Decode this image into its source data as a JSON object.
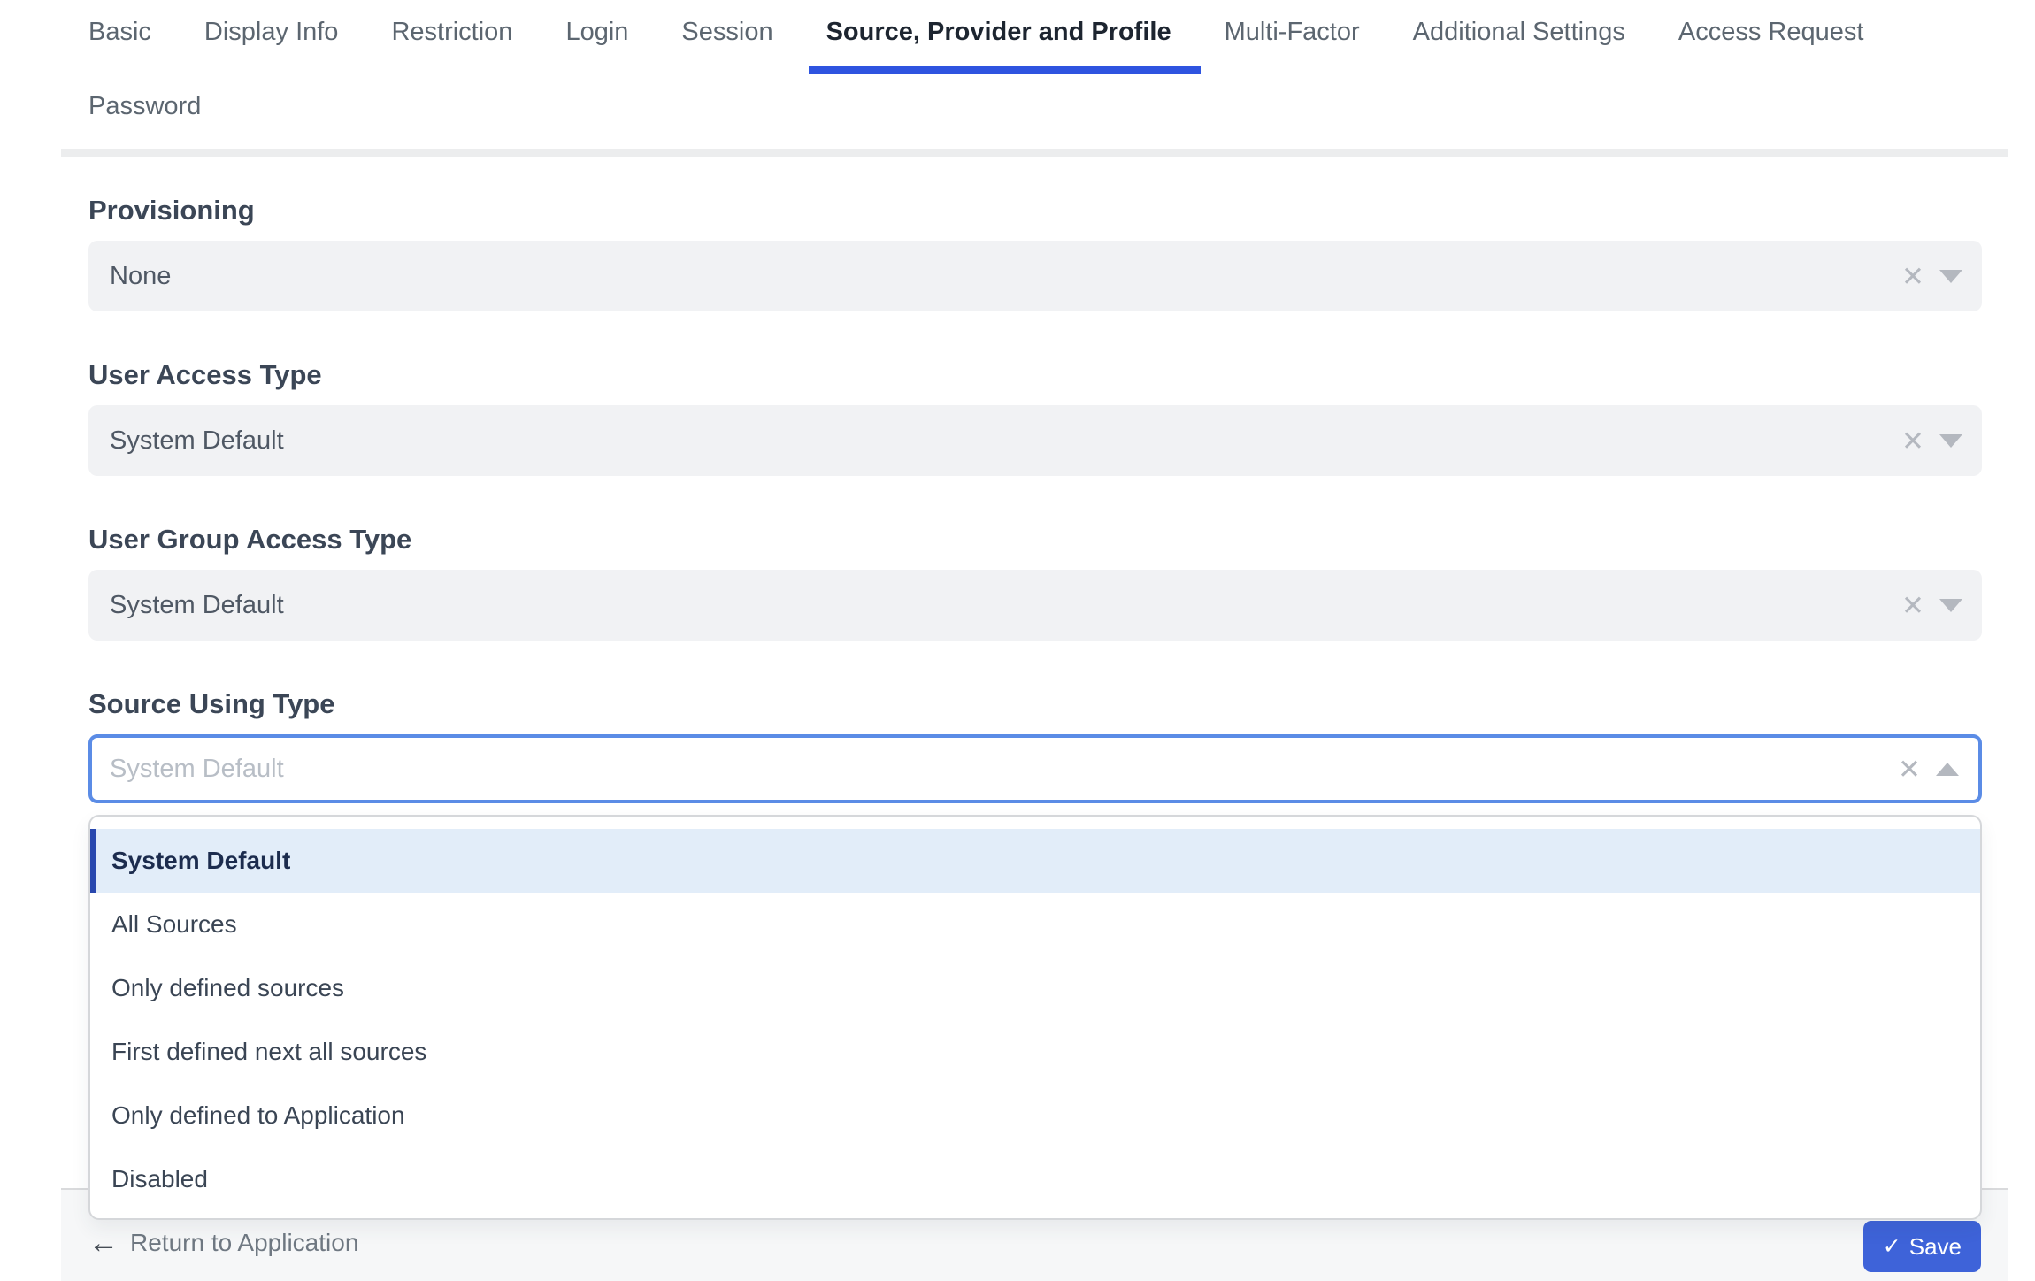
{
  "tabs": {
    "items": [
      {
        "label": "Basic",
        "active": false
      },
      {
        "label": "Display Info",
        "active": false
      },
      {
        "label": "Restriction",
        "active": false
      },
      {
        "label": "Login",
        "active": false
      },
      {
        "label": "Session",
        "active": false
      },
      {
        "label": "Source, Provider and Profile",
        "active": true
      },
      {
        "label": "Multi-Factor",
        "active": false
      },
      {
        "label": "Additional Settings",
        "active": false
      },
      {
        "label": "Access Request",
        "active": false
      },
      {
        "label": "Password",
        "active": false
      }
    ]
  },
  "form": {
    "fields": [
      {
        "label": "Provisioning",
        "value": "None"
      },
      {
        "label": "User Access Type",
        "value": "System Default"
      },
      {
        "label": "User Group Access Type",
        "value": "System Default"
      },
      {
        "label": "Source Using Type",
        "value": "",
        "placeholder": "System Default",
        "state": "open"
      }
    ]
  },
  "dropdown": {
    "options": [
      "System Default",
      "All Sources",
      "Only defined sources",
      "First defined next all sources",
      "Only defined to Application",
      "Disabled"
    ],
    "selected": "System Default"
  },
  "footer": {
    "return_label": "Return to Application",
    "save_label": "Save"
  },
  "icons": {
    "clear": "✕",
    "back_arrow": "←",
    "check": "✓"
  },
  "colors": {
    "accent-blue": "#2e54e0",
    "focus-border": "#5b8ce6",
    "save-button": "#3e63d9",
    "selected-option-bg": "#e2edf9",
    "selected-option-bar": "#2847ae"
  }
}
